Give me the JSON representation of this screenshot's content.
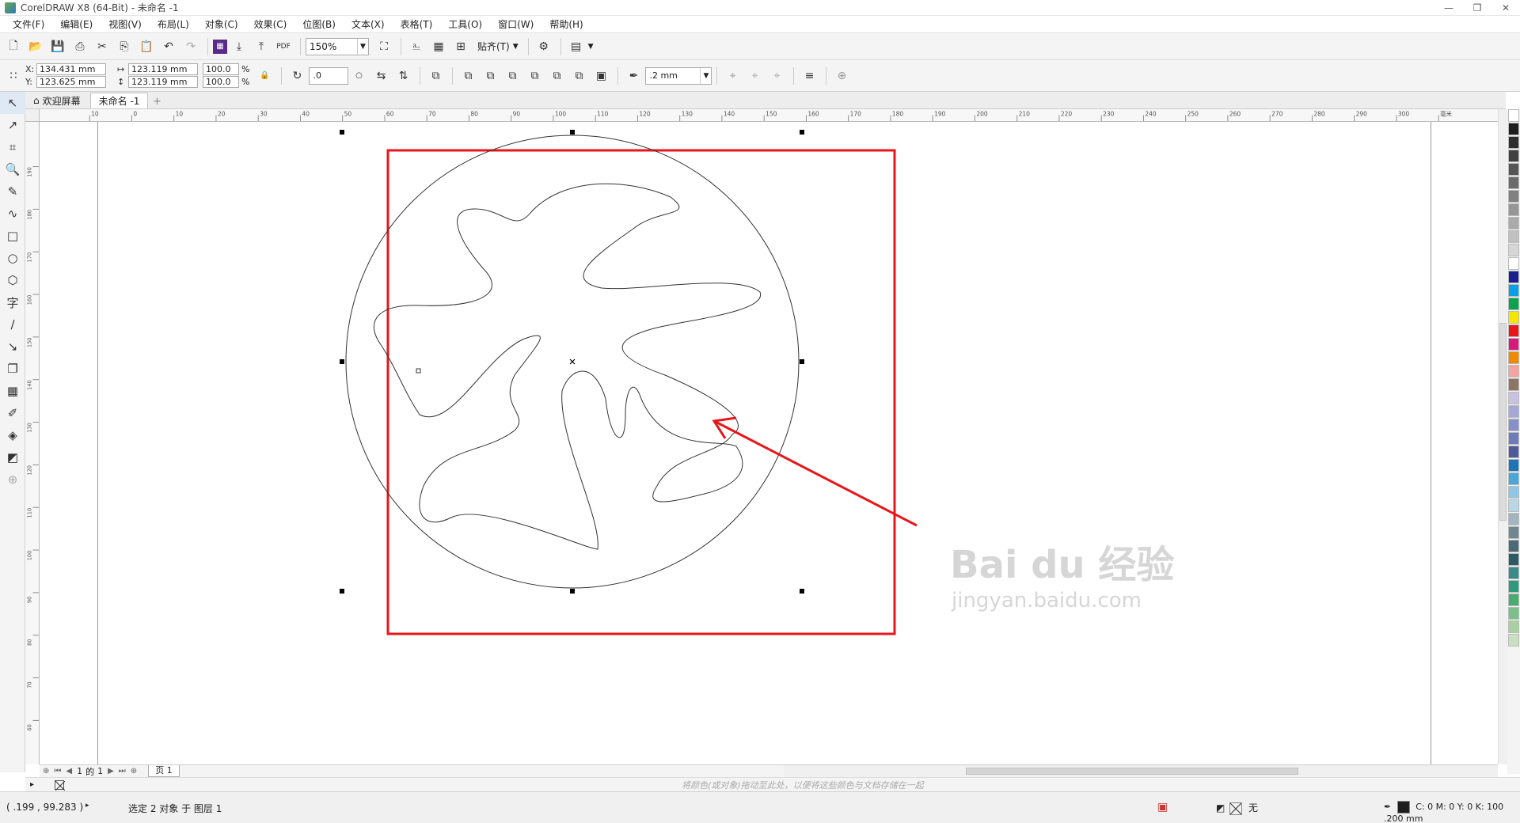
{
  "window": {
    "title": "CorelDRAW X8 (64-Bit) - 未命名 -1",
    "controls": [
      "—",
      "❐",
      "✕"
    ]
  },
  "menu": [
    "文件(F)",
    "编辑(E)",
    "视图(V)",
    "布局(L)",
    "对象(C)",
    "效果(C)",
    "位图(B)",
    "文本(X)",
    "表格(T)",
    "工具(O)",
    "窗口(W)",
    "帮助(H)"
  ],
  "toolbar": {
    "zoom": "150%",
    "snap_label": "贴齐(T)"
  },
  "property_bar": {
    "x_label": "X:",
    "x_value": "134.431 mm",
    "y_label": "Y:",
    "y_value": "123.625 mm",
    "width_value": "123.119 mm",
    "height_value": "123.119 mm",
    "scale_x": "100.0",
    "scale_y": "100.0",
    "percent": "%",
    "rotation": ".0",
    "outline_width": ".2 mm"
  },
  "doc_tabs": [
    {
      "label": "欢迎屏幕",
      "icon": "home-icon"
    },
    {
      "label": "未命名 -1",
      "active": true
    }
  ],
  "ruler_h_labels": [
    "10",
    "0",
    "10",
    "20",
    "30",
    "40",
    "50",
    "60",
    "70",
    "80",
    "90",
    "100",
    "110",
    "120",
    "130",
    "140",
    "150",
    "160",
    "170",
    "180",
    "190",
    "200",
    "210",
    "220",
    "230",
    "240",
    "250",
    "260",
    "270",
    "280",
    "290",
    "300",
    "毫米"
  ],
  "ruler_v_labels": [
    "190",
    "180",
    "170",
    "160",
    "150",
    "140",
    "130",
    "120",
    "110",
    "100",
    "90",
    "80",
    "70",
    "60"
  ],
  "pagenav": {
    "current": "1",
    "of_label": "的",
    "total": "1",
    "page_tab": "页 1"
  },
  "hint": "将颜色(或对象)拖动至此处，以便将这些颜色与文档存储在一起",
  "status": {
    "coords": "( .199 , 99.283 )",
    "selection": "选定 2 对象 于 图层 1",
    "fill": "无",
    "outline": "C: 0 M: 0 Y: 0 K: 100  .200 mm"
  },
  "watermark": {
    "brand": "Bai du 经验",
    "url": "jingyan.baidu.com"
  },
  "colors": {
    "highlight": "#e8161b",
    "palette": [
      "#ffffff",
      "#1e1e1e",
      "#2e2e2e",
      "#404040",
      "#555555",
      "#6b6b6b",
      "#808080",
      "#969696",
      "#ababab",
      "#c0c0c0",
      "#d6d6d6",
      "#ffffff",
      "#1a1f8f",
      "#0aa0e8",
      "#0aa24a",
      "#f5e600",
      "#e8161b",
      "#d81b7a",
      "#f08a00",
      "#f4a3a3",
      "#8c7565",
      "#c8c2e0",
      "#a6a8d8",
      "#8790c8",
      "#6f7ab8",
      "#4f5a98",
      "#1e74b8",
      "#49a7dc",
      "#8fc7e8",
      "#b8d8e8",
      "#a2b5c0",
      "#6e8790",
      "#4b6a78",
      "#2e5a68",
      "#3a8a8a",
      "#2e9a7a",
      "#4aaa70",
      "#7ac08a",
      "#a8d0a0",
      "#c8e0c0"
    ]
  }
}
